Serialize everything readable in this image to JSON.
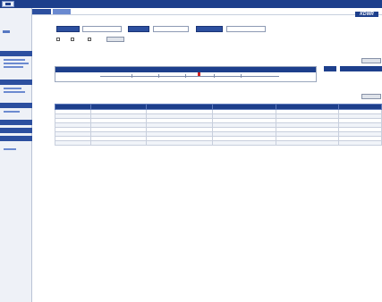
{
  "window": {
    "title": "",
    "page_title": "",
    "brand": "KDWR"
  },
  "nav": {
    "tabs": [
      "",
      ""
    ]
  },
  "sidebar": {
    "sections": [
      "",
      "",
      "",
      "",
      "",
      "",
      ""
    ]
  },
  "filters": {
    "label1": "",
    "value1": "",
    "label2": "",
    "value2": "",
    "label3": "",
    "value3": "",
    "chk_labels": [
      "",
      "",
      ""
    ],
    "refresh_label": ""
  },
  "timeline": {
    "title": "",
    "header": "",
    "ticks": [
      "",
      "",
      "",
      "",
      ""
    ],
    "marker_fraction": 0.55,
    "small_header1": "",
    "small_header2": "",
    "value1": "",
    "value2": "",
    "more_button": ""
  },
  "maintenance": {
    "title": "",
    "note": "",
    "more_button": "",
    "columns": [
      "",
      "",
      "",
      "",
      "",
      ""
    ],
    "rows": [
      [
        "",
        "",
        "",
        "",
        "",
        ""
      ],
      [
        "",
        "",
        "",
        "",
        "",
        ""
      ],
      [
        "",
        "",
        "",
        "",
        "",
        ""
      ],
      [
        "",
        "",
        "",
        "",
        "",
        ""
      ],
      [
        "",
        "",
        "",
        "",
        "",
        ""
      ],
      [
        "",
        "",
        "",
        "",
        "",
        ""
      ],
      [
        "",
        "",
        "",
        "",
        "",
        ""
      ],
      [
        "",
        "",
        "",
        "",
        "",
        ""
      ]
    ]
  }
}
